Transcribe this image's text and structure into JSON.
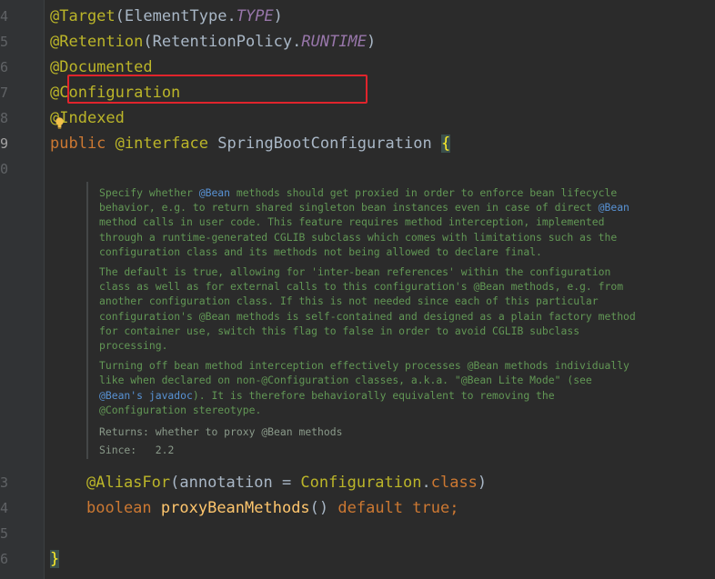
{
  "gutter": {
    "lines": [
      {
        "number": "4",
        "active": false
      },
      {
        "number": "5",
        "active": false
      },
      {
        "number": "6",
        "active": false
      },
      {
        "number": "7",
        "active": false
      },
      {
        "number": "8",
        "active": false
      },
      {
        "number": "9",
        "active": true
      },
      {
        "number": "0",
        "active": false
      },
      {
        "number": "3",
        "active": false
      },
      {
        "number": "4",
        "active": false
      },
      {
        "number": "5",
        "active": false
      },
      {
        "number": "6",
        "active": false
      }
    ]
  },
  "code": {
    "target_annotation": "@Target",
    "target_open": "(ElementType.",
    "target_const": "TYPE",
    "target_close": ")",
    "retention_annotation": "@Retention",
    "retention_open": "(RetentionPolicy.",
    "retention_const": "RUNTIME",
    "retention_close": ")",
    "documented_annotation": "@Documented",
    "configuration_annotation": "@Configuration",
    "indexed_at": "@",
    "indexed_rest": "Indexed",
    "kw_public": "public",
    "kw_interface": "@interface",
    "class_name": "SpringBootConfiguration",
    "open_brace": "{",
    "aliasfor_annotation": "@AliasFor",
    "aliasfor_args_open": "(annotation = ",
    "aliasfor_config": "Configuration",
    "aliasfor_dot": ".",
    "aliasfor_class_kw": "class",
    "aliasfor_close": ")",
    "kw_boolean": "boolean",
    "method_name": "proxyBeanMethods",
    "method_parens": "() ",
    "kw_default": "default",
    "kw_true": "true",
    "semicolon": ";",
    "close_brace": "}"
  },
  "doc": {
    "p1_l1_a": "Specify whether ",
    "p1_l1_link": "@Bean",
    "p1_l1_b": " methods should get proxied in order to enforce bean lifecycle",
    "p1_l2_a": "behavior, e.g. to return shared singleton bean instances even in case of direct ",
    "p1_l2_link": "@Bean",
    "p1_l3": "method calls in user code. This feature requires method interception, implemented",
    "p1_l4": "through a runtime-generated CGLIB subclass which comes with limitations such as the",
    "p1_l5": "configuration class and its methods not being allowed to declare final.",
    "p2_l1": "The default is true, allowing for 'inter-bean references' within the configuration",
    "p2_l2": "class as well as for external calls to this configuration's @Bean methods, e.g. from",
    "p2_l3": "another configuration class. If this is not needed since each of this particular",
    "p2_l4": "configuration's @Bean methods is self-contained and designed as a plain factory method",
    "p2_l5": "for container use, switch this flag to false in order to avoid CGLIB subclass",
    "p2_l6": "processing.",
    "p3_l1": "Turning off bean method interception effectively processes @Bean methods individually",
    "p3_l2": "like when declared on non-@Configuration classes, a.k.a. \"@Bean Lite Mode\" (see",
    "p3_l3_link": "@Bean's javadoc",
    "p3_l3_b": "). It is therefore behaviorally equivalent to removing the",
    "p3_l4": "@Configuration stereotype.",
    "returns_label": "Returns:",
    "returns_value": " whether to proxy @Bean methods",
    "since_label": "Since:",
    "since_value": "   2.2"
  },
  "colors": {
    "background": "#2b2b2b",
    "annotation": "#bbb529",
    "keyword": "#cc7832",
    "constant": "#9876aa",
    "doc_text": "#629755",
    "highlight_box": "#e0242c"
  }
}
